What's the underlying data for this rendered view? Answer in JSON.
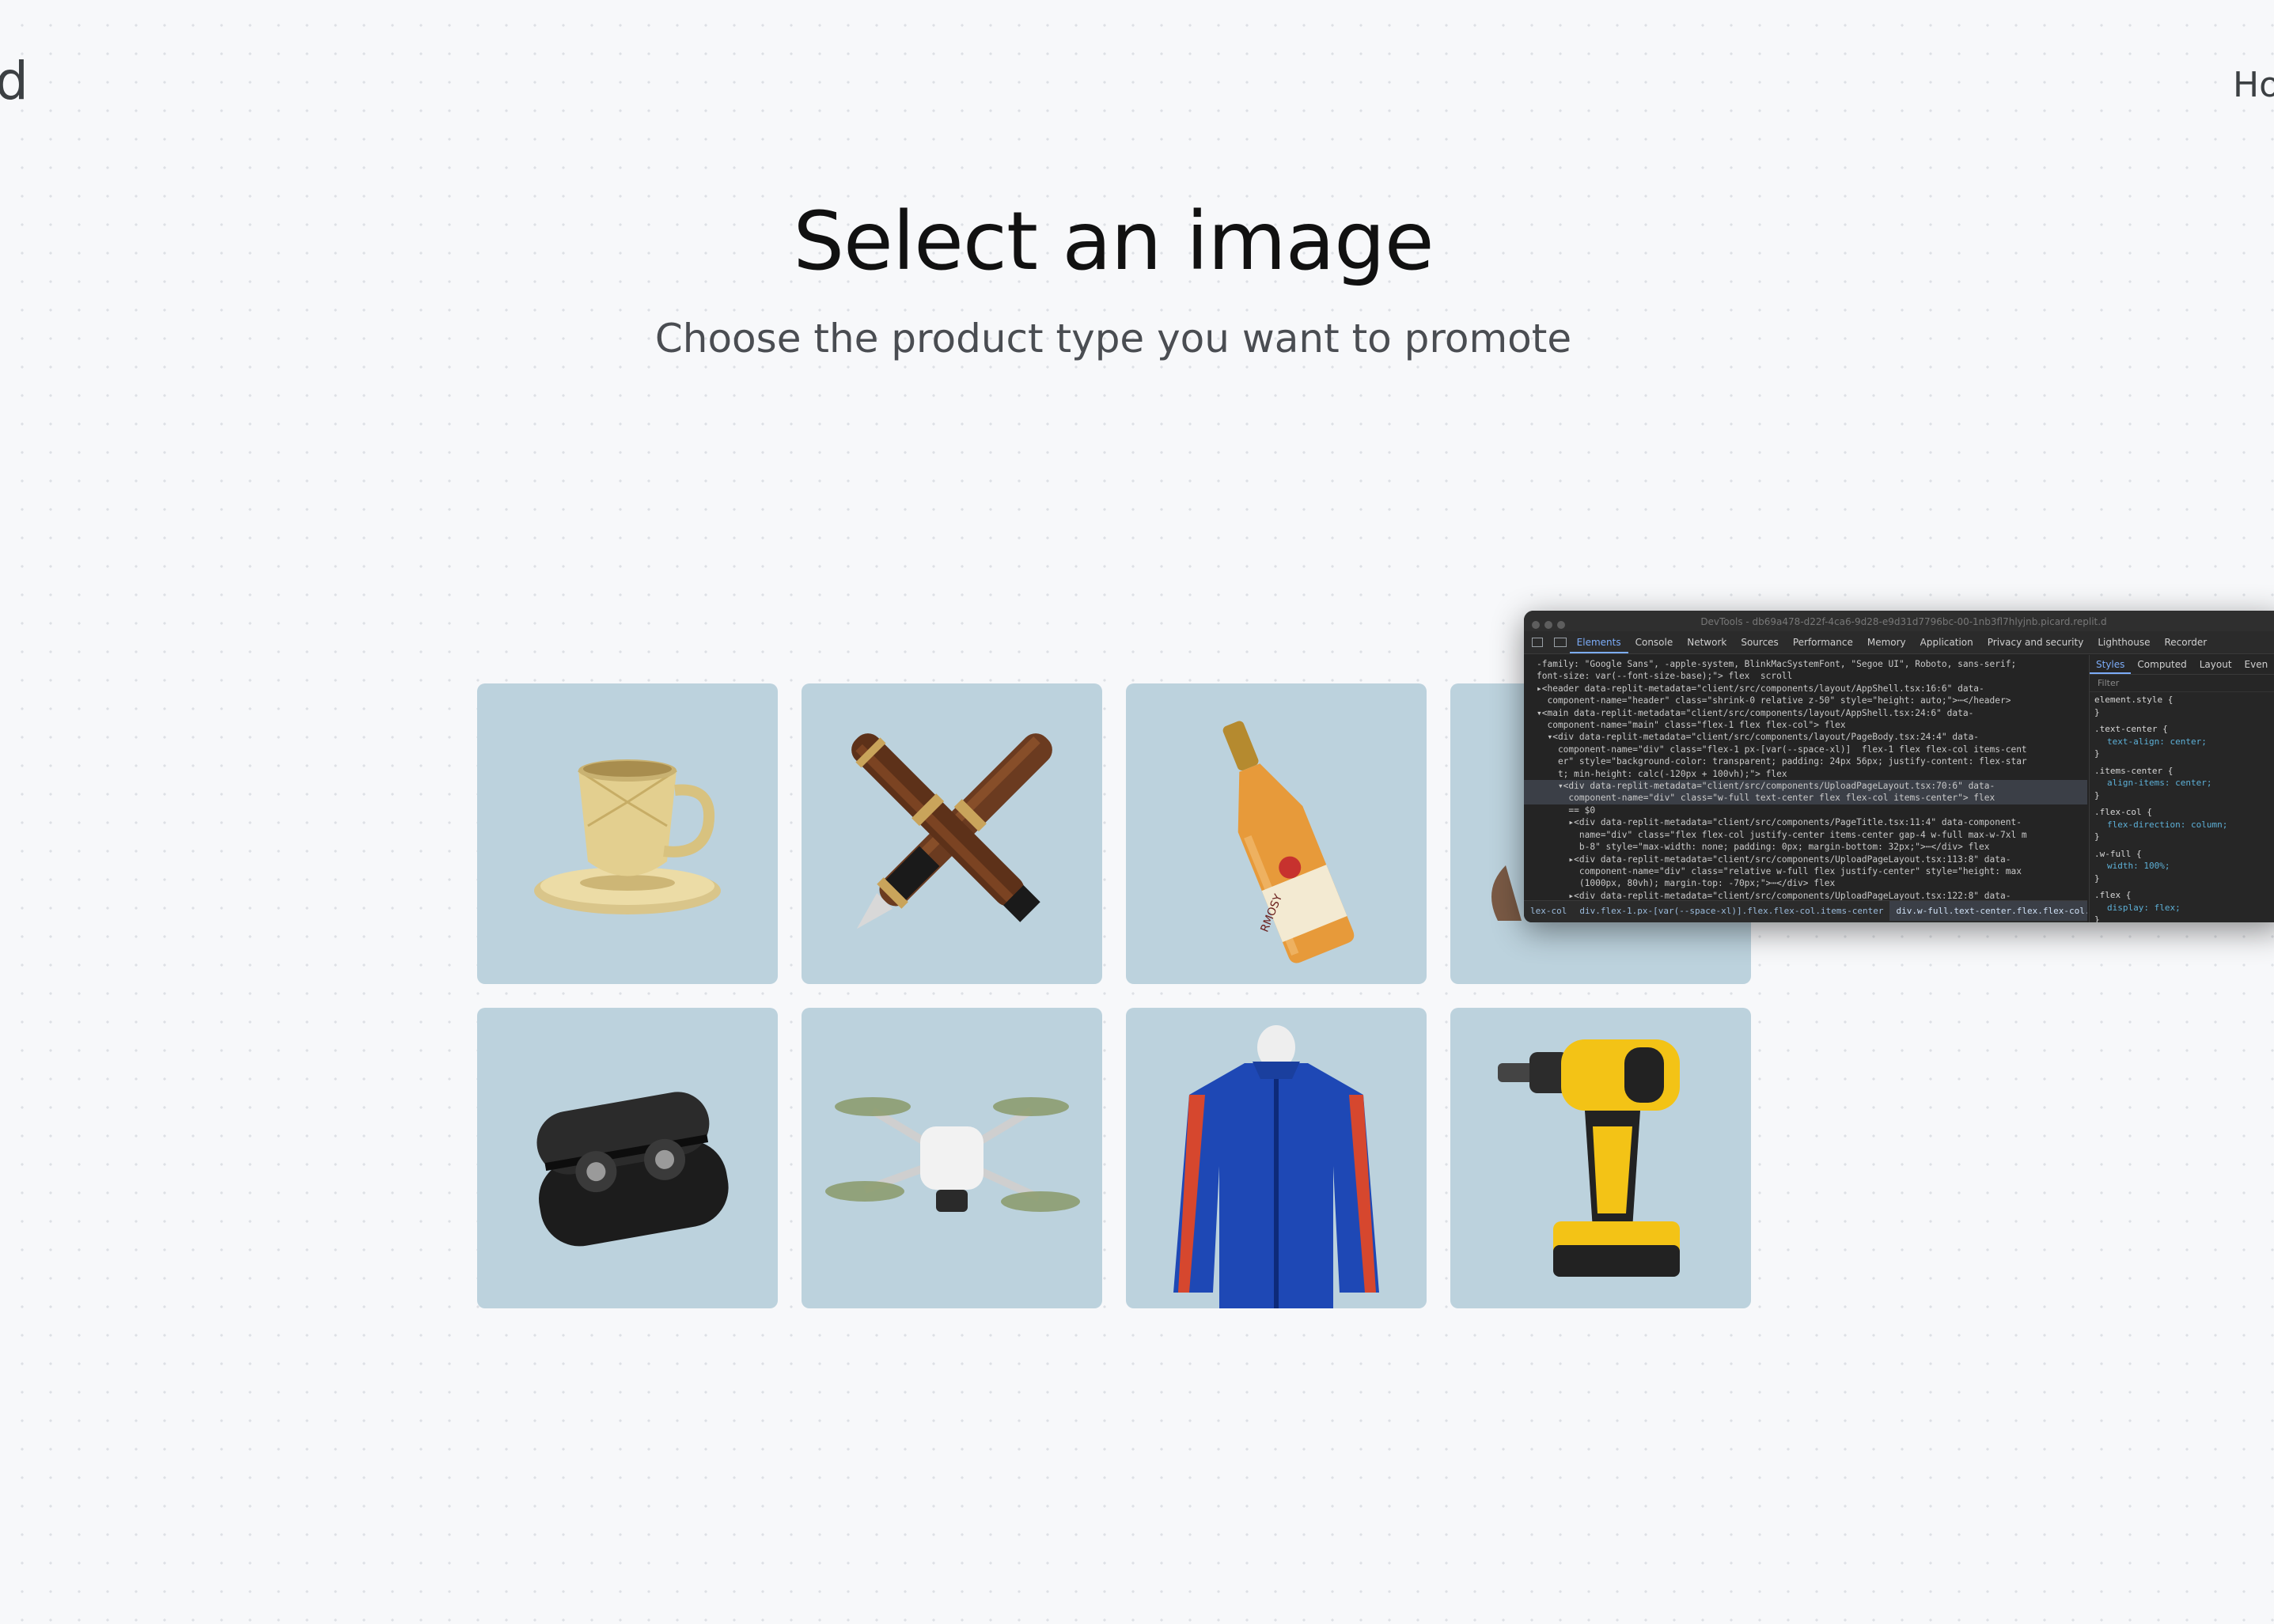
{
  "header": {
    "brand_left": "d",
    "brand_right": "Ho"
  },
  "page": {
    "title": "Select an image",
    "subtitle": "Choose the product type you want to promote"
  },
  "products": [
    {
      "name": "teacup",
      "icon": "teacup-icon"
    },
    {
      "name": "fountain-pens",
      "icon": "fountain-pens-icon"
    },
    {
      "name": "champagne-bottle",
      "icon": "champagne-bottle-icon",
      "bottle_label": "RMOSY"
    },
    {
      "name": "partially-hidden-product",
      "icon": "unknown-product-icon"
    },
    {
      "name": "earbuds-case",
      "icon": "earbuds-icon"
    },
    {
      "name": "drone",
      "icon": "drone-icon"
    },
    {
      "name": "jacket",
      "icon": "jacket-icon"
    },
    {
      "name": "power-drill",
      "icon": "drill-icon"
    }
  ],
  "colors": {
    "background": "#f7f8fa",
    "tile": "#bcd2dd",
    "devtools_bg": "#242424",
    "devtools_accent": "#7cacf8"
  },
  "devtools": {
    "title": "DevTools - db69a478-d22f-4ca6-9d28-e9d31d7796bc-00-1nb3fl7hlyjnb.picard.replit.d",
    "tabs": [
      "Elements",
      "Console",
      "Network",
      "Sources",
      "Performance",
      "Memory",
      "Application",
      "Privacy and security",
      "Lighthouse",
      "Recorder"
    ],
    "code_lines": [
      "-family: \"Google Sans\", -apple-system, BlinkMacSystemFont, \"Segoe UI\", Roboto, sans-serif;",
      "font-size: var(--font-size-base);\"> flex  scroll",
      "▸<header data-replit-metadata=\"client/src/components/layout/AppShell.tsx:16:6\" data-",
      "  component-name=\"header\" class=\"shrink-0 relative z-50\" style=\"height: auto;\">⋯</header>",
      "▾<main data-replit-metadata=\"client/src/components/layout/AppShell.tsx:24:6\" data-",
      "  component-name=\"main\" class=\"flex-1 flex flex-col\"> flex",
      "  ▾<div data-replit-metadata=\"client/src/components/layout/PageBody.tsx:24:4\" data-",
      "    component-name=\"div\" class=\"flex-1 px-[var(--space-xl)]  flex-1 flex flex-col items-cent",
      "    er\" style=\"background-color: transparent; padding: 24px 56px; justify-content: flex-star",
      "    t; min-height: calc(-120px + 100vh);\"> flex",
      "    ▾<div data-replit-metadata=\"client/src/components/UploadPageLayout.tsx:70:6\" data-",
      "      component-name=\"div\" class=\"w-full text-center flex flex-col items-center\"> flex",
      "      == $0",
      "      ▸<div data-replit-metadata=\"client/src/components/PageTitle.tsx:11:4\" data-component-",
      "        name=\"div\" class=\"flex flex-col justify-center items-center gap-4 w-full max-w-7xl m",
      "        b-8\" style=\"max-width: none; padding: 0px; margin-bottom: 32px;\">⋯</div> flex",
      "      ▸<div data-replit-metadata=\"client/src/components/UploadPageLayout.tsx:113:8\" data-",
      "        component-name=\"div\" class=\"relative w-full flex justify-center\" style=\"height: max",
      "        (1000px, 80vh); margin-top: -70px;\">⋯</div> flex",
      "      ▸<div data-replit-metadata=\"client/src/components/UploadPageLayout.tsx:122:8\" data-"
    ],
    "selected_line": 10,
    "styles_tabs": [
      "Styles",
      "Computed",
      "Layout",
      "Even"
    ],
    "filter_placeholder": "Filter",
    "rules": [
      {
        "selector": "element.style {",
        "props": []
      },
      {
        "selector": ".text-center {",
        "props": [
          "text-align: center;"
        ]
      },
      {
        "selector": ".items-center {",
        "props": [
          "align-items: center;"
        ]
      },
      {
        "selector": ".flex-col {",
        "props": [
          "flex-direction: column;"
        ]
      },
      {
        "selector": ".w-full {",
        "props": [
          "width: 100%;"
        ]
      },
      {
        "selector": ".flex {",
        "props": [
          "display: flex;"
        ]
      }
    ],
    "breadcrumbs": [
      "lex-col",
      "div.flex-1.px-[var(--space-xl)].flex.flex-col.items-center",
      "div.w-full.text-center.flex.flex-col.items-center"
    ]
  }
}
